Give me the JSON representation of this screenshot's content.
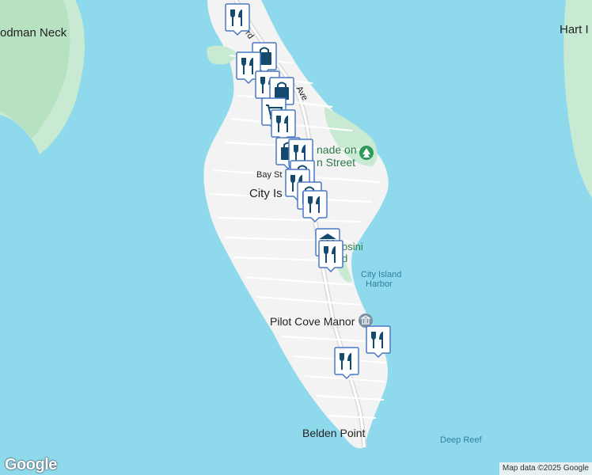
{
  "map": {
    "labels": {
      "woodman_neck": "odman Neck",
      "hart_island": "Hart I",
      "city_island": "City Is",
      "bay_st": "Bay St",
      "promenade_line1": "nade on",
      "promenade_line2": "n Street",
      "park_frag1": "osini",
      "park_frag2": "d",
      "harbor_line1": "City Island",
      "harbor_line2": "Harbor",
      "pilot_cove": "Pilot Cove Manor",
      "belden_point": "Belden Point",
      "deep_reef": "Deep Reef",
      "ave_frag": "Ave",
      "rd_frag": "rd"
    },
    "colors": {
      "water": "#8fd9ec",
      "land": "#f3f3f3",
      "park": "#c8ead2",
      "road": "#ffffff",
      "main_road": "#d9d9d9",
      "marker_fill": "#ffffff",
      "marker_border": "#4b79c4",
      "marker_icon": "#134a6d"
    },
    "markers": [
      {
        "icon": "restaurant-icon"
      },
      {
        "icon": "shopping-bag-icon"
      },
      {
        "icon": "restaurant-icon"
      },
      {
        "icon": "restaurant-icon"
      },
      {
        "icon": "shopping-bag-icon"
      },
      {
        "icon": "shopping-cart-icon"
      },
      {
        "icon": "restaurant-icon"
      },
      {
        "icon": "shopping-bag-icon"
      },
      {
        "icon": "restaurant-icon"
      },
      {
        "icon": "shopping-bag-icon"
      },
      {
        "icon": "restaurant-icon"
      },
      {
        "icon": "shopping-bag-icon"
      },
      {
        "icon": "restaurant-icon"
      },
      {
        "icon": "museum-icon"
      },
      {
        "icon": "restaurant-icon"
      },
      {
        "icon": "restaurant-icon"
      },
      {
        "icon": "restaurant-icon"
      }
    ],
    "logo": "Google",
    "attribution": "Map data ©2025 Google"
  }
}
